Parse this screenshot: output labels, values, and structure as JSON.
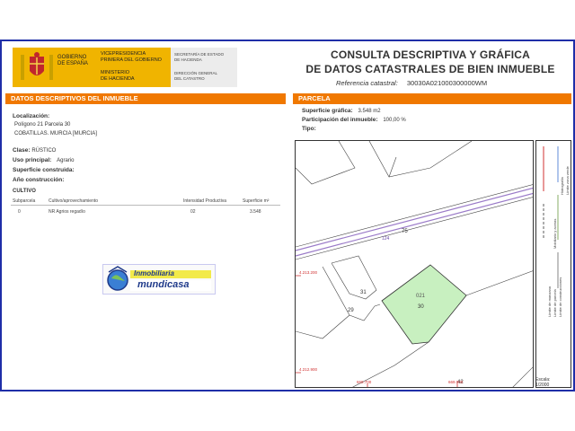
{
  "header": {
    "gov_lines": [
      "GOBIERNO",
      "DE ESPAÑA"
    ],
    "vice_lines": [
      "VICEPRESIDENCIA",
      "PRIMERA DEL GOBIERNO"
    ],
    "ministerio_lines": [
      "MINISTERIO",
      "DE HACIENDA"
    ],
    "secretaria_lines": [
      "SECRETARÍA DE ESTADO",
      "DE HACIENDA"
    ],
    "direccion_lines": [
      "DIRECCIÓN GENERAL",
      "DEL CATASTRO"
    ],
    "title_line1": "CONSULTA DESCRIPTIVA Y GRÁFICA",
    "title_line2": "DE DATOS CATASTRALES DE BIEN INMUEBLE",
    "ref_label": "Referencia catastral:",
    "ref_value": "30030A021000300000WM"
  },
  "left": {
    "section_title": "DATOS DESCRIPTIVOS DEL INMUEBLE",
    "localizacion_label": "Localización:",
    "localizacion_line1": "Polígono 21 Parcela 30",
    "localizacion_line2": "COBATILLAS. MURCIA [MURCIA]",
    "clase_label": "Clase:",
    "clase_value": "RÚSTICO",
    "uso_label": "Uso principal:",
    "uso_value": "Agrario",
    "superficie_label": "Superficie construida:",
    "anio_label": "Año construcción:",
    "cultivo_title": "CULTIVO",
    "cultivo_headers": [
      "Subparcela",
      "Cultivo/aprovechamiento",
      "Intensidad Productiva",
      "Superficie m²"
    ],
    "cultivo_rows": [
      [
        "0",
        "NR Agrios regadío",
        "02",
        "3.548"
      ]
    ],
    "logo_text_top": "Inmobiliaria",
    "logo_text_bottom": "mundicasa"
  },
  "right": {
    "section_title": "PARCELA",
    "sup_grafica_label": "Superficie gráfica:",
    "sup_grafica_value": "3.548 m2",
    "participacion_label": "Participación del inmueble:",
    "participacion_value": "100,00 %",
    "tipo_label": "Tipo:",
    "map_labels": {
      "parcel_top": "021",
      "parcel_num": "30",
      "p75": "75",
      "p31": "31",
      "p29": "29",
      "p42": "42",
      "road": "124",
      "coord_y1": "4.213.200",
      "coord_y2": "4.212.900",
      "coord_x1": "669.700",
      "coord_x2": "669.800"
    },
    "legend_items": [
      "Límite de manzana",
      "Límite de parcela",
      "Límite de construcciones",
      "Mobiliario y aceras",
      "Hidrografía",
      "Límite zona verde"
    ],
    "escala_label": "Escala:",
    "escala_value": "1/2000"
  },
  "colors": {
    "accent_orange": "#f07800",
    "frame_blue": "#1f2ea8",
    "parcel_green": "#c8f0c0",
    "gov_yellow": "#f0b400"
  }
}
